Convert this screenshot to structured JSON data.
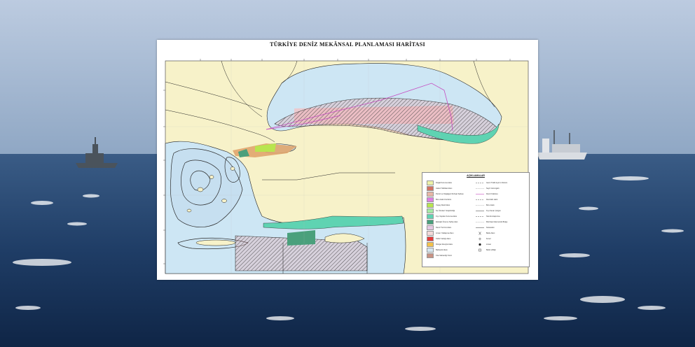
{
  "map": {
    "title": "TÜRKİYE DENİZ MEKÂNSAL PLANLAMASI HARİTASI",
    "legend_title": "AÇIKLAMALAR",
    "colors": {
      "land": "#f7f2c9",
      "sea": "#cde6f4",
      "reef_zone": "#8fd6c2",
      "hatch": "#444444",
      "pink_zone": "#e9a9ad",
      "border_lines": "#222222",
      "magenta_route": "#c54bc0"
    },
    "legend_left": [
      {
        "color": "#ecf1a7",
        "label": "Doğal Koruma Alanı"
      },
      {
        "color": "#d27263",
        "label": "Askeri Tatbikat Alanı"
      },
      {
        "color": "#e8b6a6",
        "label": "Petrol ve Doğalgaz Ruhsat Sahası"
      },
      {
        "color": "#e07ee3",
        "label": "Boru Hattı Koridoru"
      },
      {
        "color": "#b8e54f",
        "label": "Yapay Resif Alanı"
      },
      {
        "color": "#a6e9a6",
        "label": "Su Ürünleri Yetiştiriciliği"
      },
      {
        "color": "#5fd3b2",
        "label": "Kıyı Yapıları Koruma Alanı"
      },
      {
        "color": "#4aa07c",
        "label": "Ekolojik Öneme Sahip Alan"
      },
      {
        "color": "#e6c9e4",
        "label": "Deniz Turizmi Alanı"
      },
      {
        "color": "#f2dada",
        "label": "Liman Yaklaşma Alanı"
      },
      {
        "color": "#e43c3c",
        "label": "Kültür Varlığı Alanı"
      },
      {
        "color": "#f3c24a",
        "label": "Rüzgar Enerjisi Alanı"
      },
      {
        "color": "#d6e6ef",
        "label": "Balıkçılık Alanı"
      },
      {
        "color": "#c89284",
        "label": "Kıta Sahanlığı Sınırı"
      }
    ],
    "legend_right": [
      {
        "symbol": "dash",
        "label": "Gemi Trafik Ayırım Düzeni"
      },
      {
        "symbol": "dots",
        "label": "Seyir Güzergahı"
      },
      {
        "symbol": "line",
        "label": "Deniz Kablosu"
      },
      {
        "symbol": "dash",
        "label": "Denizaltı Hattı"
      },
      {
        "symbol": "dots",
        "label": "Boru Hattı"
      },
      {
        "symbol": "line",
        "label": "Kıyı Kenar Çizgisi"
      },
      {
        "symbol": "dash",
        "label": "Sismik Araştırma"
      },
      {
        "symbol": "dots",
        "label": "Münhasır Ekonomik Bölge"
      },
      {
        "symbol": "line",
        "label": "Karasuları"
      },
      {
        "symbol": "x",
        "label": "Batık Alanı"
      },
      {
        "symbol": "plus",
        "label": "Fener"
      },
      {
        "symbol": "circle",
        "label": "Liman"
      },
      {
        "symbol": "square",
        "label": "Balık Çiftliği"
      }
    ]
  }
}
